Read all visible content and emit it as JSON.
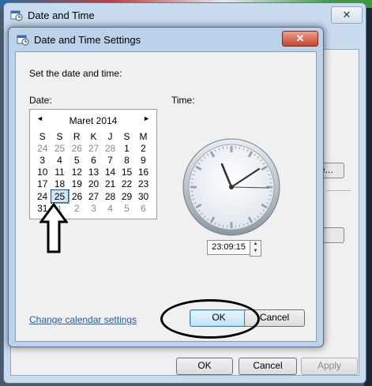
{
  "parent_window": {
    "title": "Date and Time",
    "close_glyph": "✕",
    "change_button_label": "e...",
    "ok_label": "OK",
    "cancel_label": "Cancel",
    "apply_label": "Apply"
  },
  "dialog": {
    "title": "Date and Time Settings",
    "close_glyph": "✕",
    "instruction": "Set the date and time:",
    "date_label": "Date:",
    "time_label": "Time:",
    "calendar": {
      "month": "Maret 2014",
      "prev_glyph": "◄",
      "next_glyph": "►",
      "weekdays": [
        "S",
        "S",
        "R",
        "K",
        "J",
        "S",
        "M"
      ],
      "rows": [
        [
          "24",
          "25",
          "26",
          "27",
          "28",
          "1",
          "2"
        ],
        [
          "3",
          "4",
          "5",
          "6",
          "7",
          "8",
          "9"
        ],
        [
          "10",
          "11",
          "12",
          "13",
          "14",
          "15",
          "16"
        ],
        [
          "17",
          "18",
          "19",
          "20",
          "21",
          "22",
          "23"
        ],
        [
          "24",
          "25",
          "26",
          "27",
          "28",
          "29",
          "30"
        ],
        [
          "31",
          "1",
          "2",
          "3",
          "4",
          "5",
          "6"
        ]
      ],
      "selected_day": "25"
    },
    "time_value": "23:09:15",
    "change_calendar_link": "Change calendar settings",
    "ok_label": "OK",
    "cancel_label": "Cancel"
  },
  "icons": {
    "window_icon": "calendar-clock-icon",
    "up_arrow_annotation": "up-arrow-annotation-icon"
  },
  "colors": {
    "dialog_frame": "#bcd2ea",
    "client_bg": "#f0f0f0",
    "link": "#1f5ea8",
    "selected_day_bg": "#cfe6fb"
  }
}
